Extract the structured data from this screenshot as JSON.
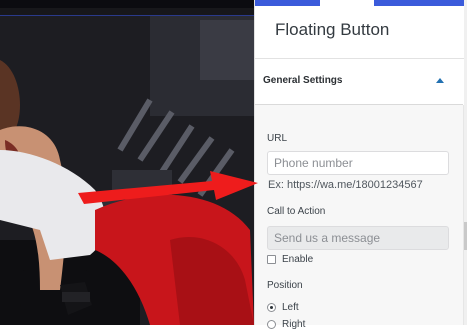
{
  "panel": {
    "title": "Floating Button",
    "section_title": "General Settings",
    "url_label": "URL",
    "url_placeholder": "Phone number",
    "url_hint": "Ex: https://wa.me/18001234567",
    "cta_label": "Call to Action",
    "cta_placeholder": "Send us a message",
    "enable_label": "Enable",
    "position_label": "Position",
    "position_options": [
      "Left",
      "Right"
    ],
    "position_selected": "Left"
  },
  "colors": {
    "accent": "#2271b1",
    "arrow": "#ee1c1c",
    "tab_active": "#3b5bdb"
  },
  "icons": {
    "section_toggle": "caret-up-icon"
  }
}
